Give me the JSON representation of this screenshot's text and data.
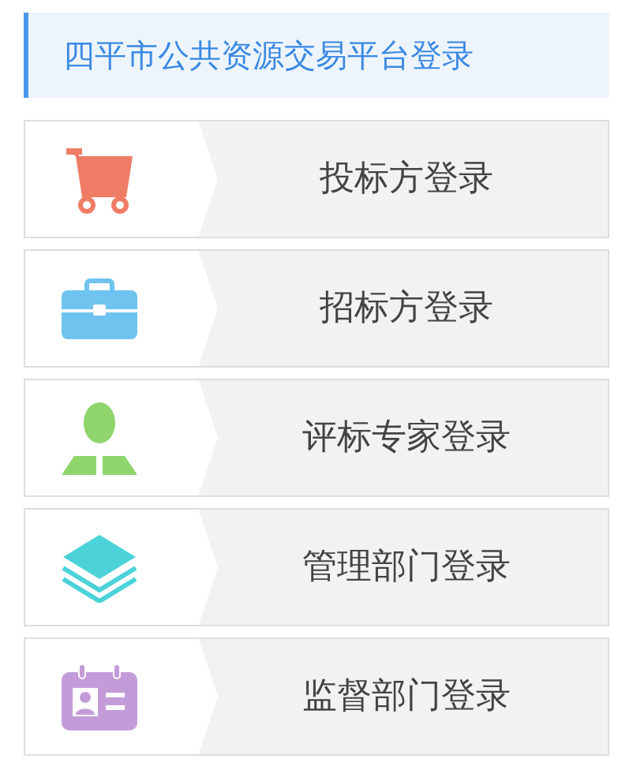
{
  "title": "四平市公共资源交易平台登录",
  "logins": [
    {
      "kind": "cart",
      "label": "投标方登录"
    },
    {
      "kind": "briefcase",
      "label": "招标方登录"
    },
    {
      "kind": "person",
      "label": "评标专家登录"
    },
    {
      "kind": "layers",
      "label": "管理部门登录"
    },
    {
      "kind": "badge",
      "label": "监督部门登录"
    }
  ]
}
